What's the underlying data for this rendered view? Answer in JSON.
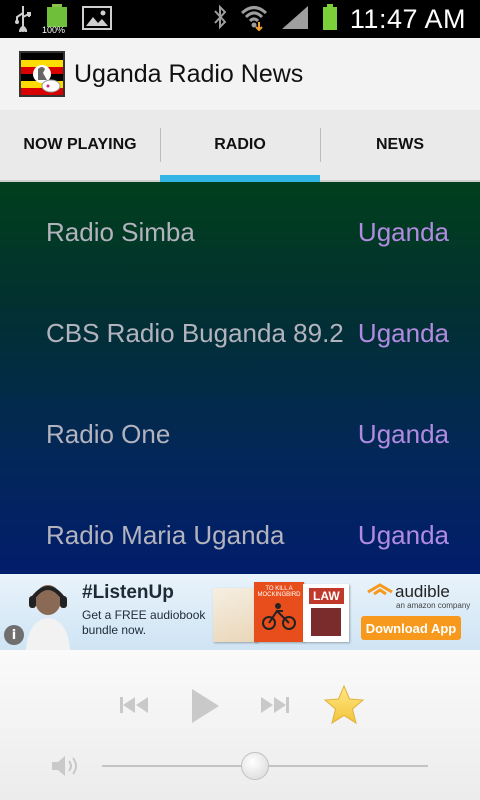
{
  "status_bar": {
    "icons": [
      "usb-icon",
      "battery-full-icon",
      "image-icon",
      "bluetooth-icon",
      "wifi-icon",
      "signal-icon",
      "battery-icon"
    ],
    "battery_badge": "100%",
    "time": "11:47 AM"
  },
  "title_bar": {
    "icon": "uganda-flag-icon",
    "title": "Uganda Radio News"
  },
  "tabs": [
    {
      "label": "NOW PLAYING",
      "active": false
    },
    {
      "label": "RADIO",
      "active": true
    },
    {
      "label": "NEWS",
      "active": false
    }
  ],
  "stations": [
    {
      "name": "Radio Simba",
      "country": "Uganda"
    },
    {
      "name": "CBS Radio Buganda 89.2",
      "country": "Uganda"
    },
    {
      "name": "Radio One",
      "country": "Uganda"
    },
    {
      "name": "Radio Maria Uganda",
      "country": "Uganda"
    }
  ],
  "ad": {
    "hashtag": "#ListenUp",
    "subtext": "Get a FREE audiobook bundle now.",
    "book_label_1": "TO KILL A MOCKINGBIRD",
    "book_label_2": "LAW",
    "brand": "audible",
    "brand_sub": "an amazon company",
    "cta": "Download App",
    "info": "i"
  },
  "player": {
    "controls": [
      "previous-icon",
      "play-icon",
      "next-icon",
      "favorite-star-icon",
      "volume-icon"
    ],
    "volume_level": 0.47
  },
  "colors": {
    "accent": "#33b5e5",
    "station_text": "#b3b3bd",
    "country_text": "#b08be0",
    "cta": "#f7991c"
  }
}
